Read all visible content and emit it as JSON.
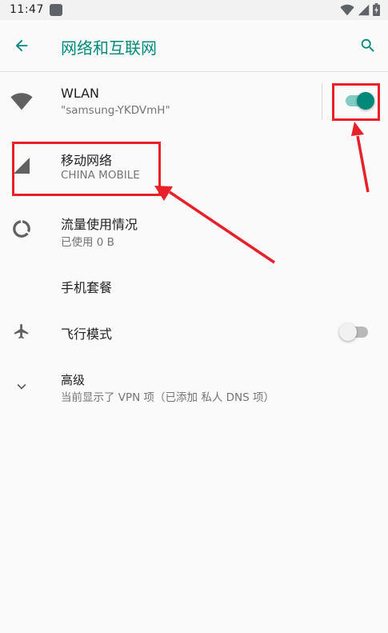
{
  "status_bar": {
    "time": "11:47",
    "icons": [
      "notification-icon",
      "wifi-icon",
      "signal-icon",
      "battery-charging-icon"
    ]
  },
  "app_bar": {
    "title": "网络和互联网",
    "back_icon": "arrow-back-icon",
    "search_icon": "search-icon"
  },
  "prefs": [
    {
      "key": "wlan",
      "icon": "wifi-icon",
      "title": "WLAN",
      "summary": "\"samsung-YKDVmH\"",
      "switch_on": true
    },
    {
      "key": "mobile",
      "icon": "cell-signal-icon",
      "title": "移动网络",
      "summary": "CHINA MOBILE"
    },
    {
      "key": "data_usage",
      "icon": "data-usage-icon",
      "title": "流量使用情况",
      "summary": "已使用 0 B"
    },
    {
      "key": "plan",
      "title": "手机套餐"
    },
    {
      "key": "airplane",
      "icon": "airplane-icon",
      "title": "飞行模式",
      "switch_on": false
    },
    {
      "key": "advanced",
      "icon": "chevron-down-icon",
      "title": "高级",
      "summary": "当前显示了 VPN 项（已添加 私人 DNS 项）"
    }
  ],
  "colors": {
    "accent": "#00897b",
    "switch_on_track": "#80cbc4",
    "switch_off_thumb": "#f1f1f1",
    "switch_off_track": "#b9b9b9",
    "annotation": "#e8202a",
    "icon_gray": "#616161"
  }
}
